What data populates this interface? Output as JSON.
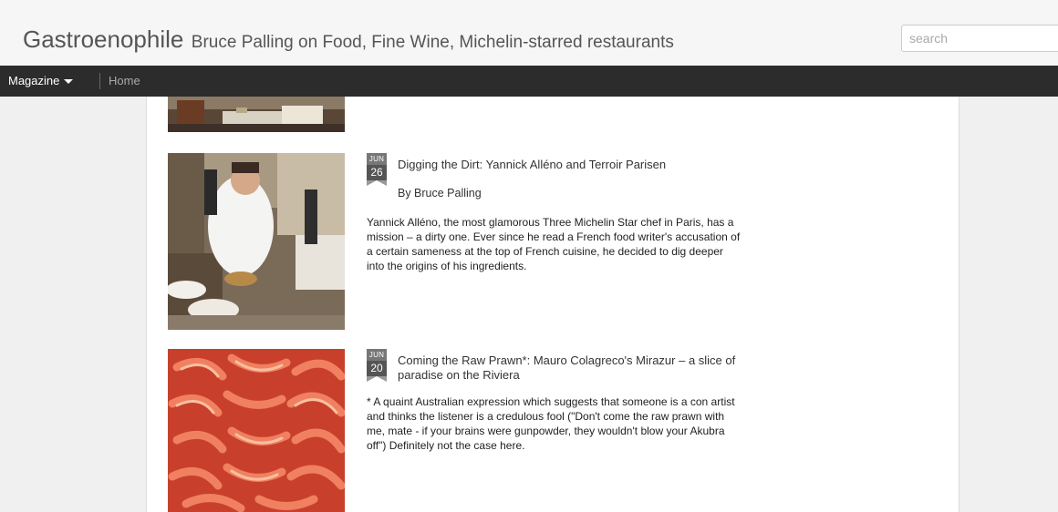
{
  "header": {
    "site_name": "Gastroenophile",
    "tagline": "Bruce Palling on Food, Fine Wine, Michelin-starred restaurants",
    "search_placeholder": "search"
  },
  "nav": {
    "magazine_label": "Magazine",
    "home_label": "Home"
  },
  "posts": [
    {
      "month": "JUN",
      "day": "26",
      "title": "Digging the Dirt: Yannick Alléno and Terroir Parisen",
      "byline": "By Bruce Palling",
      "excerpt": "Yannick Alléno, the most glamorous Three Michelin Star chef in Paris, has a mission – a dirty one. Ever since he read a French food writer's accusation of a certain sameness at the top of French cuisine, he decided to dig deeper into the origins of his ingredients."
    },
    {
      "month": "JUN",
      "day": "20",
      "title": "Coming the Raw Prawn*:  Mauro Colagreco's Mirazur – a slice of paradise on the Riviera",
      "excerpt": "* A quaint Australian expression which suggests that someone is a con artist and thinks the listener is a credulous fool (\"Don't come the raw prawn with me, mate - if your brains were gunpowder, they wouldn't blow your Akubra off\") Definitely not the case here."
    }
  ]
}
